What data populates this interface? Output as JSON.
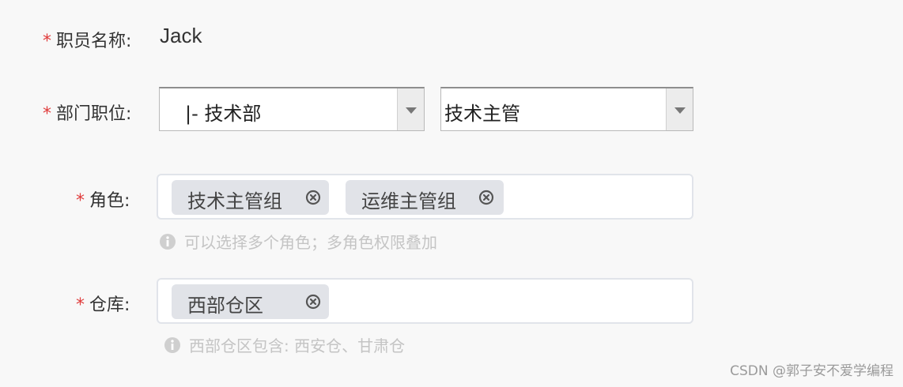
{
  "fields": {
    "name": {
      "required_mark": "*",
      "label": "职员名称:",
      "value": "Jack"
    },
    "department": {
      "required_mark": "*",
      "label": "部门职位:",
      "dept_select": {
        "value": "|- 技术部",
        "icon": "chevron-down-icon"
      },
      "position_select": {
        "value": "技术主管",
        "icon": "chevron-down-icon"
      }
    },
    "role": {
      "required_mark": "*",
      "label": "角色:",
      "tags": [
        {
          "label": "技术主管组",
          "icon": "close-circle-icon"
        },
        {
          "label": "运维主管组",
          "icon": "close-circle-icon"
        }
      ],
      "hint": "可以选择多个角色；多角色权限叠加",
      "hint_icon": "info-icon"
    },
    "warehouse": {
      "required_mark": "*",
      "label": "仓库:",
      "tags": [
        {
          "label": "西部仓区",
          "icon": "close-circle-icon"
        }
      ],
      "hint": "西部仓区包含: 西安仓、甘肃仓",
      "hint_icon": "info-icon"
    }
  },
  "watermark": "CSDN @郭子安不爱学编程",
  "colors": {
    "required": "#e03c3c",
    "tag_bg": "#e1e3e8",
    "hint": "#c4c4c4",
    "background": "#f8f8f8"
  }
}
